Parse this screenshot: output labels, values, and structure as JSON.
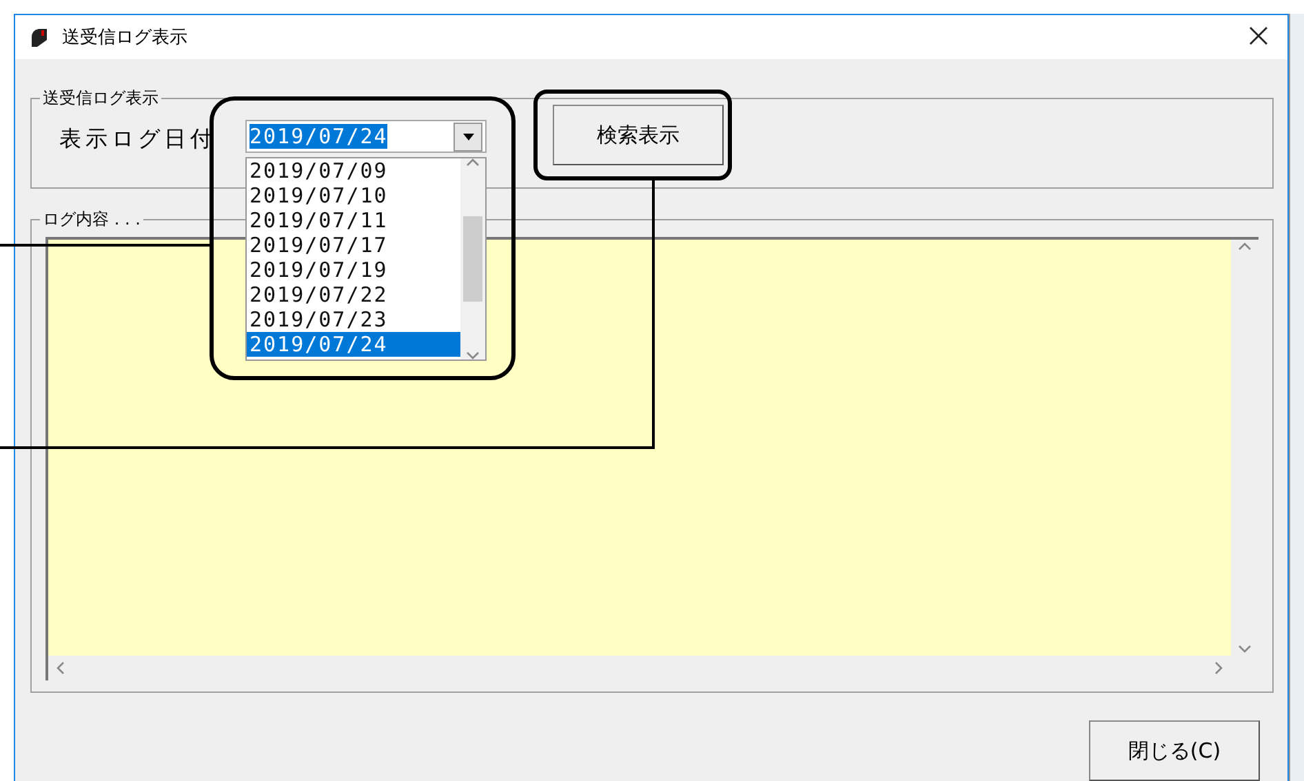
{
  "window": {
    "title": "送受信ログ表示"
  },
  "date_group": {
    "legend": "送受信ログ表示",
    "label": "表示ログ日付",
    "value": "2019/07/24",
    "options": [
      {
        "label": "2019/07/09",
        "selected": false
      },
      {
        "label": "2019/07/10",
        "selected": false
      },
      {
        "label": "2019/07/11",
        "selected": false
      },
      {
        "label": "2019/07/17",
        "selected": false
      },
      {
        "label": "2019/07/19",
        "selected": false
      },
      {
        "label": "2019/07/22",
        "selected": false
      },
      {
        "label": "2019/07/23",
        "selected": false
      },
      {
        "label": "2019/07/24",
        "selected": true
      }
    ],
    "search_button": "検索表示"
  },
  "log_group": {
    "legend": "ログ内容 . . ."
  },
  "buttons": [
    "閉じる(C)"
  ]
}
